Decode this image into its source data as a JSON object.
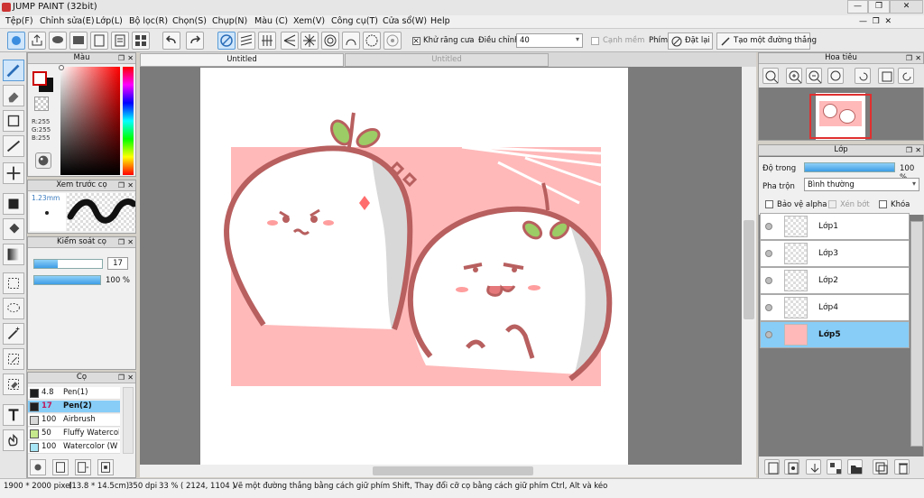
{
  "window": {
    "title": "JUMP PAINT (32bit)"
  },
  "menu": [
    "Tệp(F)",
    "Chỉnh sửa(E)",
    "Lớp(L)",
    "Bộ lọc(R)",
    "Chọn(S)",
    "Chụp(N)",
    "Màu (C)",
    "Xem(V)",
    "Công cụ(T)",
    "Cửa sổ(W)",
    "Help"
  ],
  "toolbar": {
    "antialias_label": "Khử răng cưa",
    "adjust_label": "Điều chỉnh",
    "adjust_value": "40",
    "edge_label": "Cạnh mềm",
    "key_label": "Phím",
    "reset_label": "Đặt lại",
    "line_label": "Tạo một đường thẳng"
  },
  "tabs": [
    {
      "label": "Untitled",
      "active": true
    },
    {
      "label": "Untitled",
      "active": false
    }
  ],
  "color_panel": {
    "title": "Màu",
    "r": "R:255",
    "g": "G:255",
    "b": "B:255"
  },
  "preview_panel": {
    "title": "Xem trước cọ",
    "size": "1.23mm"
  },
  "brush_control_panel": {
    "title": "Kiểm soát cọ",
    "size_value": "17",
    "opacity": "100 %"
  },
  "brush_panel": {
    "title": "Cọ",
    "items": [
      {
        "size": "4.8",
        "name": "Pen(1)",
        "color": "#1e1e1e",
        "selected": false
      },
      {
        "size": "17",
        "name": "Pen(2)",
        "color": "#1e1e1e",
        "selected": true
      },
      {
        "size": "100",
        "name": "Airbrush",
        "color": "#d8d8d8",
        "selected": false
      },
      {
        "size": "50",
        "name": "Fluffy Watercol",
        "color": "#c7e98d",
        "selected": false
      },
      {
        "size": "100",
        "name": "Watercolor (W",
        "color": "#a8e6f5",
        "selected": false
      }
    ]
  },
  "navigator": {
    "title": "Hoa tiêu"
  },
  "layer_panel": {
    "title": "Lớp",
    "opacity_label": "Độ trong",
    "opacity_value": "100 %",
    "blend_label": "Pha trộn",
    "blend_value": "Bình thường",
    "protect_alpha": "Bảo vệ alpha",
    "clip": "Xén bớt",
    "lock": "Khóa",
    "layers": [
      {
        "name": "Lớp1",
        "selected": false
      },
      {
        "name": "Lớp3",
        "selected": false
      },
      {
        "name": "Lớp2",
        "selected": false
      },
      {
        "name": "Lớp4",
        "selected": false
      },
      {
        "name": "Lớp5",
        "selected": true
      }
    ]
  },
  "status": {
    "doc_size": "1900 * 2000 pixel",
    "doc_cm": "(13.8 * 14.5cm)",
    "dpi": "350 dpi",
    "zoom": "33 %",
    "coords": "( 2124, 1104 )",
    "hint": "Vẽ một đường thẳng bằng cách giữ phím Shift, Thay đổi cỡ cọ bằng cách giữ phím Ctrl, Alt và kéo"
  },
  "colors": {
    "accent": "#87cdf7",
    "canvas_pink": "#ffb9b9",
    "stroke": "#c06a6a"
  }
}
